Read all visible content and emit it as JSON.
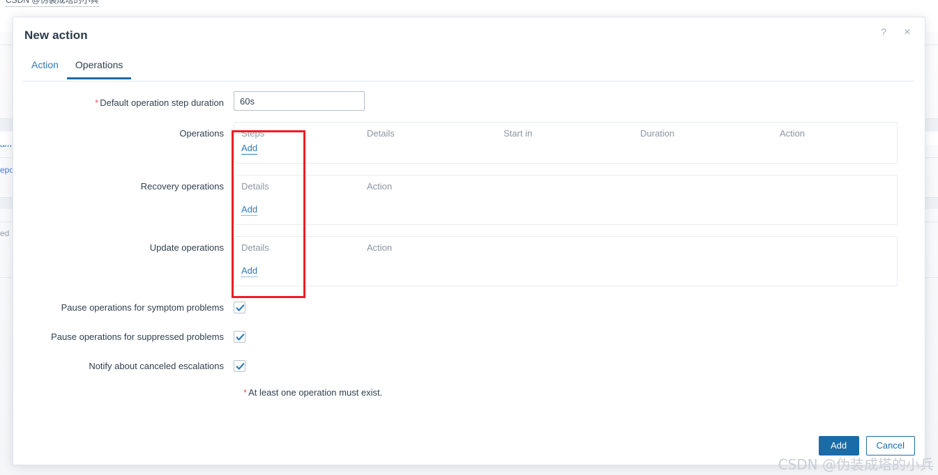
{
  "background": {
    "top_fragment": "CSDN @伪装成塔的小兵",
    "fragments": [
      {
        "text": "am",
        "kind": "link"
      },
      {
        "text": "epo",
        "kind": "link"
      },
      {
        "text": "ed",
        "kind": "muted"
      }
    ]
  },
  "dialog": {
    "title": "New action",
    "help_icon": "?",
    "close_icon": "×",
    "tabs": [
      {
        "label": "Action",
        "active": false
      },
      {
        "label": "Operations",
        "active": true
      }
    ],
    "duration_field": {
      "label": "Default operation step duration",
      "required_marker": "*",
      "value": "60s",
      "placeholder": ""
    },
    "operations": {
      "label": "Operations",
      "columns": [
        "Steps",
        "Details",
        "Start in",
        "Duration",
        "Action"
      ],
      "rows": [],
      "add_label": "Add"
    },
    "recovery_operations": {
      "label": "Recovery operations",
      "columns": [
        "Details",
        "Action"
      ],
      "rows": [],
      "add_label": "Add"
    },
    "update_operations": {
      "label": "Update operations",
      "columns": [
        "Details",
        "Action"
      ],
      "rows": [],
      "add_label": "Add"
    },
    "checkboxes": [
      {
        "label": "Pause operations for symptom problems",
        "checked": true
      },
      {
        "label": "Pause operations for suppressed problems",
        "checked": true
      },
      {
        "label": "Notify about canceled escalations",
        "checked": true
      }
    ],
    "validation_note": {
      "marker": "*",
      "text": "At least one operation must exist."
    },
    "footer": {
      "submit_label": "Add",
      "cancel_label": "Cancel"
    }
  },
  "annotation": {
    "color": "#ee1c25",
    "shape": "rectangle"
  },
  "watermark": "CSDN @伪装成塔的小兵",
  "colors": {
    "accent": "#1a6ca8",
    "link": "#2e7ab8",
    "required": "#e45959",
    "text": "#31404f",
    "muted": "#8b96a3",
    "annotation": "#ee1c25"
  }
}
